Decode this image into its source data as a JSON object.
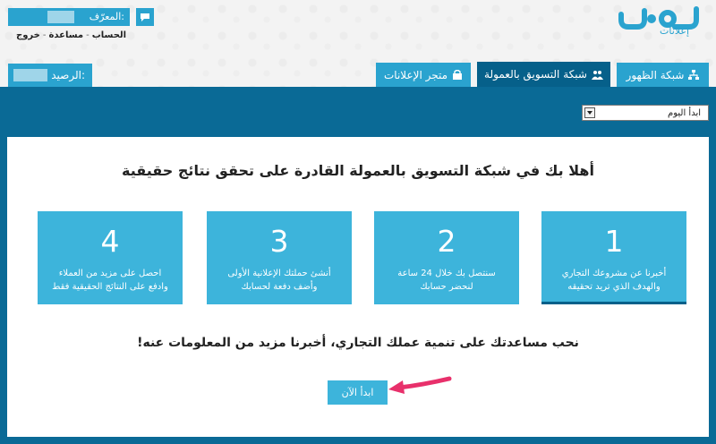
{
  "logo": {
    "text": "حسوب",
    "subtitle": "إعلانات"
  },
  "user": {
    "label": "المعرّف:",
    "links": [
      "الحساب",
      "مساعدة",
      "خروج"
    ]
  },
  "balance": {
    "label": "الرصيد:"
  },
  "nav": {
    "tabs": [
      {
        "label": "شبكة الظهور",
        "icon": "network-icon",
        "active": false
      },
      {
        "label": "شبكة التسويق بالعمولة",
        "icon": "users-icon",
        "active": true
      },
      {
        "label": "متجر الإعلانات",
        "icon": "store-icon",
        "active": false
      }
    ]
  },
  "select": {
    "value": "ابدأ اليوم"
  },
  "main": {
    "title": "أهلا بك في شبكة التسويق بالعمولة القادرة على تحقق نتائج حقيقية",
    "steps": [
      {
        "num": "1",
        "line1": "أخبرنا عن مشروعك التجاري",
        "line2": "والهدف الذي تريد تحقيقه"
      },
      {
        "num": "2",
        "line1": "سنتصل بك خلال 24 ساعة",
        "line2": "لنحضر حسابك"
      },
      {
        "num": "3",
        "line1": "أنشئ حملتك الإعلانية الأولى",
        "line2": "وأضف دفعة لحسابك"
      },
      {
        "num": "4",
        "line1": "احصل على مزيد من العملاء",
        "line2": "وادفع على النتائج الحقيقية فقط"
      }
    ],
    "subtitle": "نحب مساعدتك على تنمية عملك التجاري، أخبرنا مزيد من المعلومات عنه!",
    "start_button": "ابدأ الآن"
  },
  "colors": {
    "accent": "#2aa3cf",
    "dark": "#06608a",
    "band": "#0a6a96",
    "card": "#3db4db",
    "arrow": "#e8306b"
  }
}
